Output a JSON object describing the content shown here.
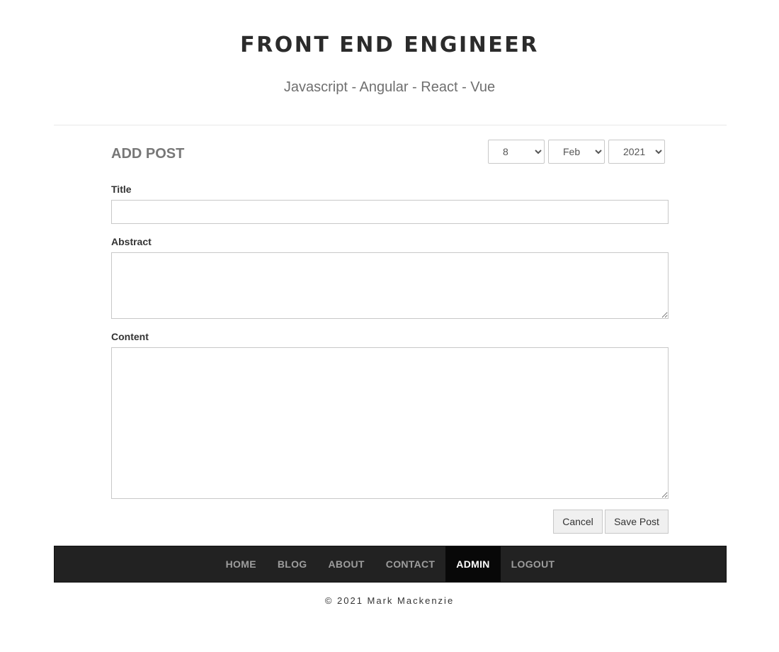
{
  "header": {
    "title": "FRONT END ENGINEER",
    "subtitle": "Javascript - Angular - React - Vue"
  },
  "form": {
    "heading": "ADD POST",
    "date": {
      "day": "8",
      "month": "Feb",
      "year": "2021"
    },
    "title_label": "Title",
    "title_value": "",
    "abstract_label": "Abstract",
    "abstract_value": "",
    "content_label": "Content",
    "content_value": "",
    "cancel_label": "Cancel",
    "save_label": "Save Post"
  },
  "nav": {
    "items": [
      {
        "label": "HOME",
        "active": false
      },
      {
        "label": "BLOG",
        "active": false
      },
      {
        "label": "ABOUT",
        "active": false
      },
      {
        "label": "CONTACT",
        "active": false
      },
      {
        "label": "ADMIN",
        "active": true
      },
      {
        "label": "LOGOUT",
        "active": false
      }
    ]
  },
  "footer": {
    "copyright": "© 2021 Mark Mackenzie"
  },
  "colors": {
    "nav_background": "#222222",
    "nav_active_background": "#080808",
    "nav_text": "#9d9d9d",
    "nav_active_text": "#ffffff"
  }
}
